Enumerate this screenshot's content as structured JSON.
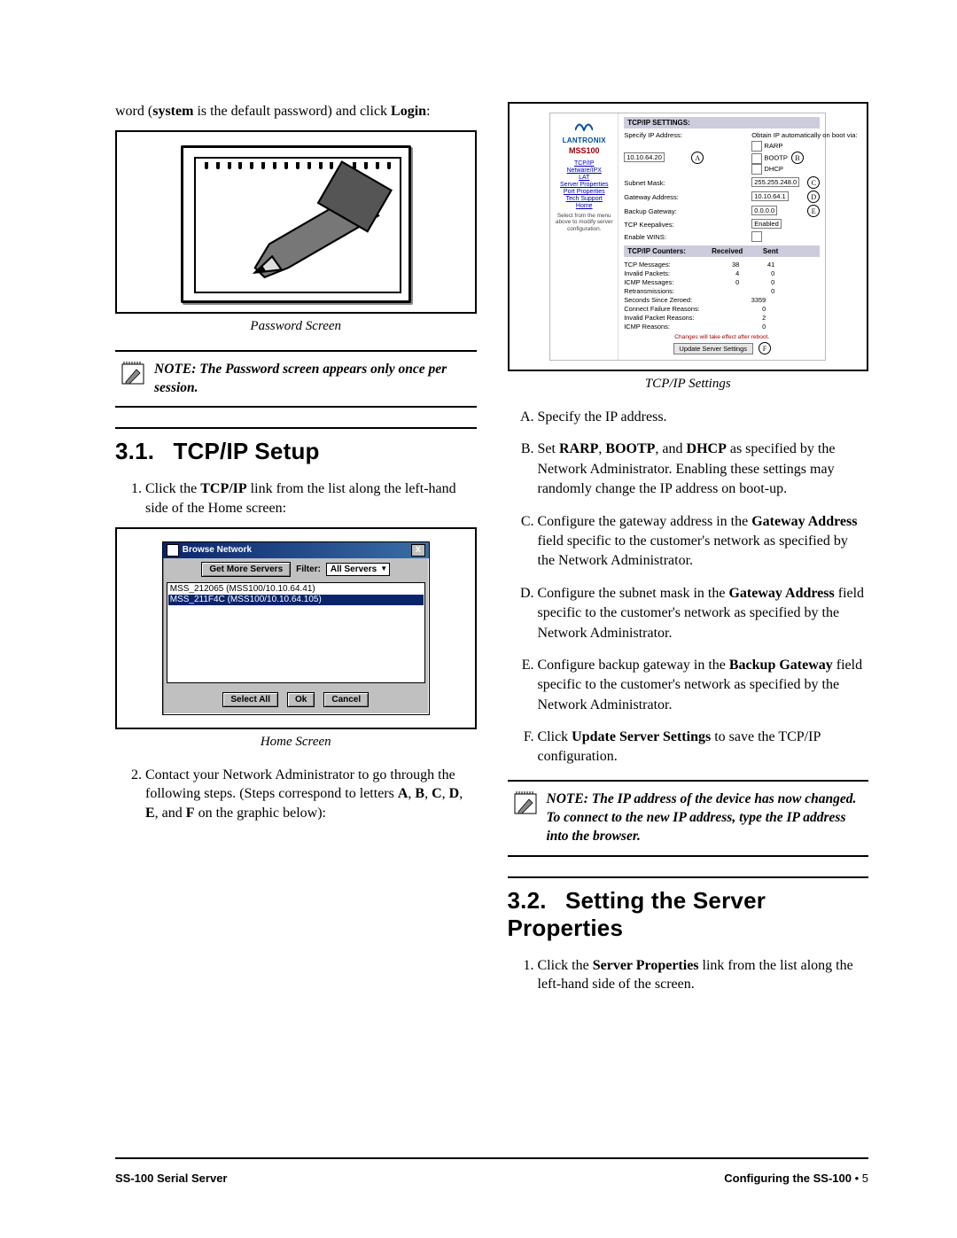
{
  "intro": {
    "before": "word (",
    "bold1": "system",
    "mid": " is the default password) and click ",
    "bold2": "Login",
    "after": ":"
  },
  "caption_password": "Password Screen",
  "note1": "NOTE: The Password screen appears only once per session.",
  "sec31_num": "3.1.",
  "sec31_title": "TCP/IP Setup",
  "step31_1a": "Click the ",
  "step31_1b": "TCP/IP",
  "step31_1c": " link from the list along the left-hand side of the Home screen:",
  "caption_home": "Home Screen",
  "step31_2a": "Contact your Network Administrator to go through the following steps. (Steps correspond to letters ",
  "step31_2_letters": [
    "A",
    "B",
    "C",
    "D",
    "E",
    "F"
  ],
  "step31_2b": " on the graphic below):",
  "dlg": {
    "title": "Browse Network",
    "get_more": "Get More Servers",
    "filter_lbl": "Filter:",
    "filter_val": "All Servers",
    "rows": [
      "MSS_212065 (MSS100/10.10.64.41)",
      "MSS_211F4C (MSS100/10.10.64.105)"
    ],
    "select_all": "Select All",
    "ok": "Ok",
    "cancel": "Cancel"
  },
  "caption_tcpip": "TCP/IP Settings",
  "letters": {
    "A": "Specify the IP address.",
    "B_pre": "Set ",
    "B_b1": "RARP",
    "B_c1": ", ",
    "B_b2": "BOOTP",
    "B_c2": ", and ",
    "B_b3": "DHCP",
    "B_post": " as specified by the Network Administrator. Enabling these settings may randomly change the IP address on boot-up.",
    "C_pre": "Configure the gateway address in the ",
    "C_b": "Gateway Address",
    "C_post": " field specific to the customer's network as specified by the Network Administrator.",
    "D_pre": "Configure the subnet mask in the ",
    "D_b": "Gateway Address",
    "D_post": " field specific to the customer's network as specified by the Network Administrator.",
    "E_pre": "Configure backup gateway in the ",
    "E_b": "Backup Gateway",
    "E_post": " field specific to the customer's network as specified by the Network Administrator.",
    "F_pre": "Click ",
    "F_b": "Update Server Settings",
    "F_post": " to save the TCP/IP configuration."
  },
  "note2": "NOTE: The IP address of the device has now changed. To connect to the new IP address, type the IP address into the browser.",
  "sec32_num": "3.2.",
  "sec32_title": "Setting the Server Properties",
  "step32_1a": "Click the ",
  "step32_1b": "Server Properties",
  "step32_1c": " link from the list along the left-hand side of the screen.",
  "tcp": {
    "logo": "LANTRONIX",
    "mss": "MSS100",
    "links": [
      "TCP/IP",
      "Netware/IPX",
      "LAT",
      "Server Properties",
      "Port Properties",
      "Tech Support",
      "Home"
    ],
    "hint": "Select from the menu above to modify server configuration.",
    "hdr1": "TCP/IP SETTINGS:",
    "specify": "Specify IP Address:",
    "ip": "10.10.64.20",
    "obtain": "Obtain IP automatically on boot via:",
    "rarp": "RARP",
    "bootp": "BOOTP",
    "dhcp": "DHCP",
    "subnet_l": "Subnet Mask:",
    "subnet_v": "255.255.248.0",
    "gw_l": "Gateway Address:",
    "gw_v": "10.10.64.1",
    "bgw_l": "Backup Gateway:",
    "bgw_v": "0.0.0.0",
    "keep_l": "TCP Keepalives:",
    "keep_v": "Enabled",
    "wins_l": "Enable WINS:",
    "hdr2": "TCP/IP Counters:",
    "recv": "Received",
    "sent": "Sent",
    "rows": [
      [
        "TCP Messages:",
        "38",
        "41"
      ],
      [
        "Invalid Packets:",
        "4",
        "0"
      ],
      [
        "ICMP Messages:",
        "0",
        "0"
      ],
      [
        "Retransmissions:",
        "",
        "0"
      ]
    ],
    "rows2": [
      [
        "Seconds Since Zeroed:",
        "3359"
      ],
      [
        "Connect Failure Reasons:",
        "0"
      ],
      [
        "Invalid Packet Reasons:",
        "2"
      ],
      [
        "ICMP Reasons:",
        "0"
      ]
    ],
    "notice": "Changes will take effect after reboot.",
    "update": "Update Server Settings"
  },
  "footer_left": "SS-100 Serial Server",
  "footer_right_bold": "Configuring the SS-100",
  "footer_right_tail": " • 5"
}
